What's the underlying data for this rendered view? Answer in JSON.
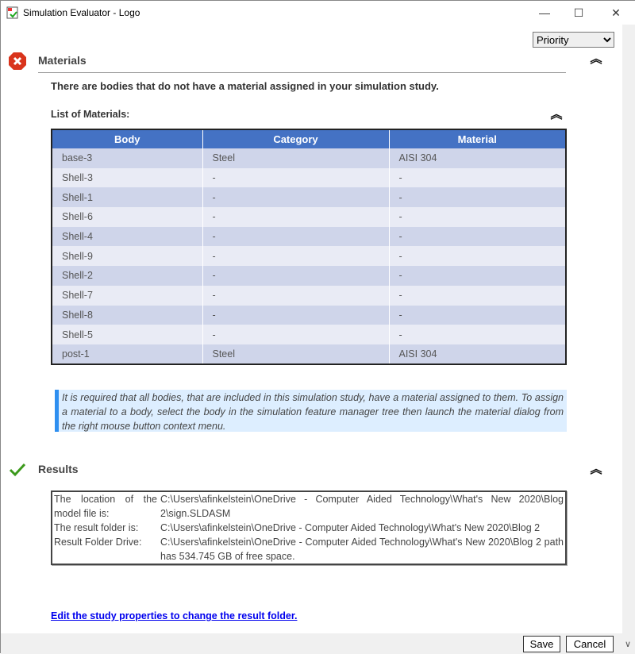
{
  "window": {
    "title": "Simulation Evaluator - Logo",
    "minimize": "—",
    "maximize": "☐",
    "close": "✕"
  },
  "sort": {
    "selected": "Priority"
  },
  "materials": {
    "title": "Materials",
    "status": "error",
    "message": "There are bodies that do not have a material assigned in your simulation study.",
    "list_title": "List of Materials:",
    "columns": [
      "Body",
      "Category",
      "Material"
    ],
    "rows": [
      [
        "base-3",
        "Steel",
        "AISI 304"
      ],
      [
        "Shell-3",
        "-",
        "-"
      ],
      [
        "Shell-1",
        "-",
        "-"
      ],
      [
        "Shell-6",
        "-",
        "-"
      ],
      [
        "Shell-4",
        "-",
        "-"
      ],
      [
        "Shell-9",
        "-",
        "-"
      ],
      [
        "Shell-2",
        "-",
        "-"
      ],
      [
        "Shell-7",
        "-",
        "-"
      ],
      [
        "Shell-8",
        "-",
        "-"
      ],
      [
        "Shell-5",
        "-",
        "-"
      ],
      [
        "post-1",
        "Steel",
        "AISI 304"
      ]
    ],
    "note": "It is required that all bodies, that are included in this simulation study, have a material assigned to them. To assign a material to a body, select the body in the simulation feature manager tree then launch the material dialog from the right mouse button context menu."
  },
  "results": {
    "title": "Results",
    "status": "ok",
    "rows": [
      {
        "label": "The location of the model file is:",
        "value": "C:\\Users\\afinkelstein\\OneDrive - Computer Aided Technology\\What's New 2020\\Blog 2\\sign.SLDASM"
      },
      {
        "label": "The result folder is:",
        "value": "C:\\Users\\afinkelstein\\OneDrive - Computer Aided Technology\\What's New 2020\\Blog 2"
      },
      {
        "label": "Result Folder Drive:",
        "value": "C:\\Users\\afinkelstein\\OneDrive - Computer Aided Technology\\What's New 2020\\Blog 2 path has 534.745 GB of free space."
      }
    ],
    "link": "Edit the study properties to change the result folder."
  },
  "buttons": {
    "save": "Save",
    "cancel": "Cancel"
  },
  "colors": {
    "header": "#4472c4",
    "error": "#d9341c",
    "ok": "#3c9a1c",
    "link": "#0000ee"
  }
}
